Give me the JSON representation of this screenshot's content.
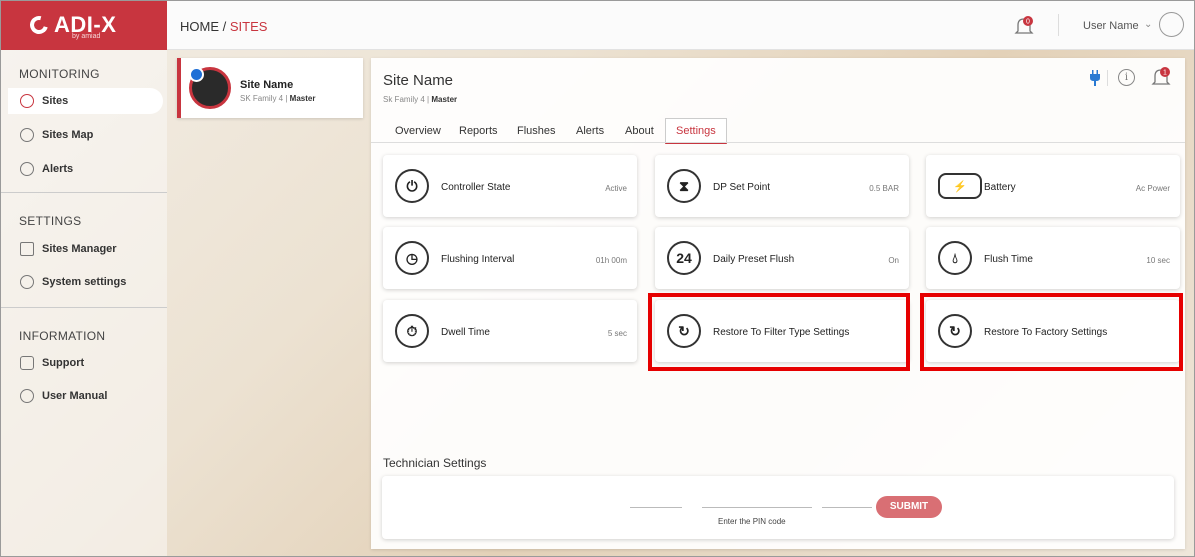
{
  "brand": {
    "logo_text": "ADI-X",
    "logo_sub": "by amiad",
    "accent": "#c8353f"
  },
  "breadcrumb": {
    "home": "HOME",
    "separator": "/",
    "current": "SITES"
  },
  "user": {
    "name": "User Name",
    "notifications": "0"
  },
  "sidebar": {
    "sections": [
      {
        "title": "MONITORING"
      },
      {
        "title": "SETTINGS"
      },
      {
        "title": "INFORMATION"
      }
    ],
    "items": [
      {
        "label": "Sites",
        "icon": "sites-icon",
        "active": true
      },
      {
        "label": "Sites Map",
        "icon": "map-icon"
      },
      {
        "label": "Alerts",
        "icon": "bell-icon"
      },
      {
        "label": "Sites Manager",
        "icon": "manager-icon"
      },
      {
        "label": "System settings",
        "icon": "gear-icon"
      },
      {
        "label": "Support",
        "icon": "chat-icon"
      },
      {
        "label": "User Manual",
        "icon": "info-icon"
      }
    ]
  },
  "site_card": {
    "name": "Site Name",
    "family": "SK Family 4",
    "sep": "|",
    "role": "Master"
  },
  "main": {
    "title": "Site Name",
    "family": "Sk Family 4",
    "sep": "|",
    "role": "Master",
    "alert_count": "1",
    "tabs": [
      {
        "label": "Overview"
      },
      {
        "label": "Reports"
      },
      {
        "label": "Flushes"
      },
      {
        "label": "Alerts"
      },
      {
        "label": "About"
      },
      {
        "label": "Settings",
        "active": true
      }
    ],
    "tiles": [
      {
        "label": "Controller State",
        "value": "Active",
        "icon": "power-icon"
      },
      {
        "label": "DP Set Point",
        "value": "0.5 BAR",
        "icon": "gauge-icon"
      },
      {
        "label": "Battery",
        "value": "Ac Power",
        "icon": "battery-icon"
      },
      {
        "label": "Flushing Interval",
        "value": "01h 00m",
        "icon": "clock-icon"
      },
      {
        "label": "Daily Preset Flush",
        "value": "On",
        "icon": "24h-icon"
      },
      {
        "label": "Flush Time",
        "value": "10 sec",
        "icon": "water-drop-icon"
      },
      {
        "label": "Dwell Time",
        "value": "5 sec",
        "icon": "stopwatch-icon"
      },
      {
        "label": "Restore To Filter Type Settings",
        "value": "",
        "icon": "refresh-icon"
      },
      {
        "label": "Restore To Factory Settings",
        "value": "",
        "icon": "refresh-icon"
      }
    ],
    "icon_text": {
      "24h": "24"
    },
    "technician": {
      "title": "Technician Settings",
      "pin_hint": "Enter the PIN code",
      "submit_label": "SUBMIT"
    }
  }
}
